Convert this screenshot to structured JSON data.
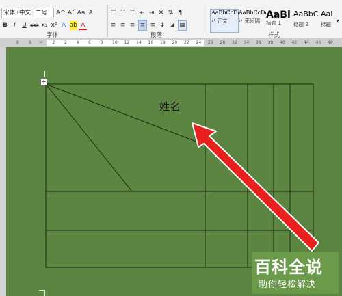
{
  "ribbon": {
    "font": {
      "font_name": "宋体 (中文正)",
      "font_size": "二号",
      "group_label": "字体",
      "row1_buttons": [
        "A^",
        "A˅",
        "Aa",
        "A"
      ],
      "row2_buttons": [
        "B",
        "I",
        "U",
        "abc",
        "x₂",
        "x²",
        "A",
        "ab",
        "A"
      ]
    },
    "paragraph": {
      "group_label": "段落"
    },
    "styles": {
      "group_label": "样式",
      "items": [
        {
          "sample": "AaBbCcDd",
          "name": "↵ 正文"
        },
        {
          "sample": "AaBbCcDd",
          "name": "↵ 无间隔"
        },
        {
          "sample": "AaBl",
          "name": "标题 1"
        },
        {
          "sample": "AaBbC",
          "name": "标题 2"
        },
        {
          "sample": "AaBbC",
          "name": "标题"
        }
      ]
    }
  },
  "ruler": {
    "numbers": [
      "8",
      "6",
      "4",
      "2",
      "2",
      "4",
      "6",
      "8",
      "10",
      "12",
      "14",
      "16",
      "18",
      "20",
      "22",
      "24",
      "26",
      "28",
      "32",
      "34",
      "36",
      "38",
      "40",
      "42",
      "44",
      "46",
      "48"
    ]
  },
  "document": {
    "cell_text": "姓名",
    "table_anchor": "✛"
  },
  "watermark": {
    "title": "百科全说",
    "subtitle": "助你轻松解决"
  },
  "colors": {
    "page_background": "#5b8540",
    "arrow": "#e8211f",
    "logo_green": "#6a9a4a"
  }
}
